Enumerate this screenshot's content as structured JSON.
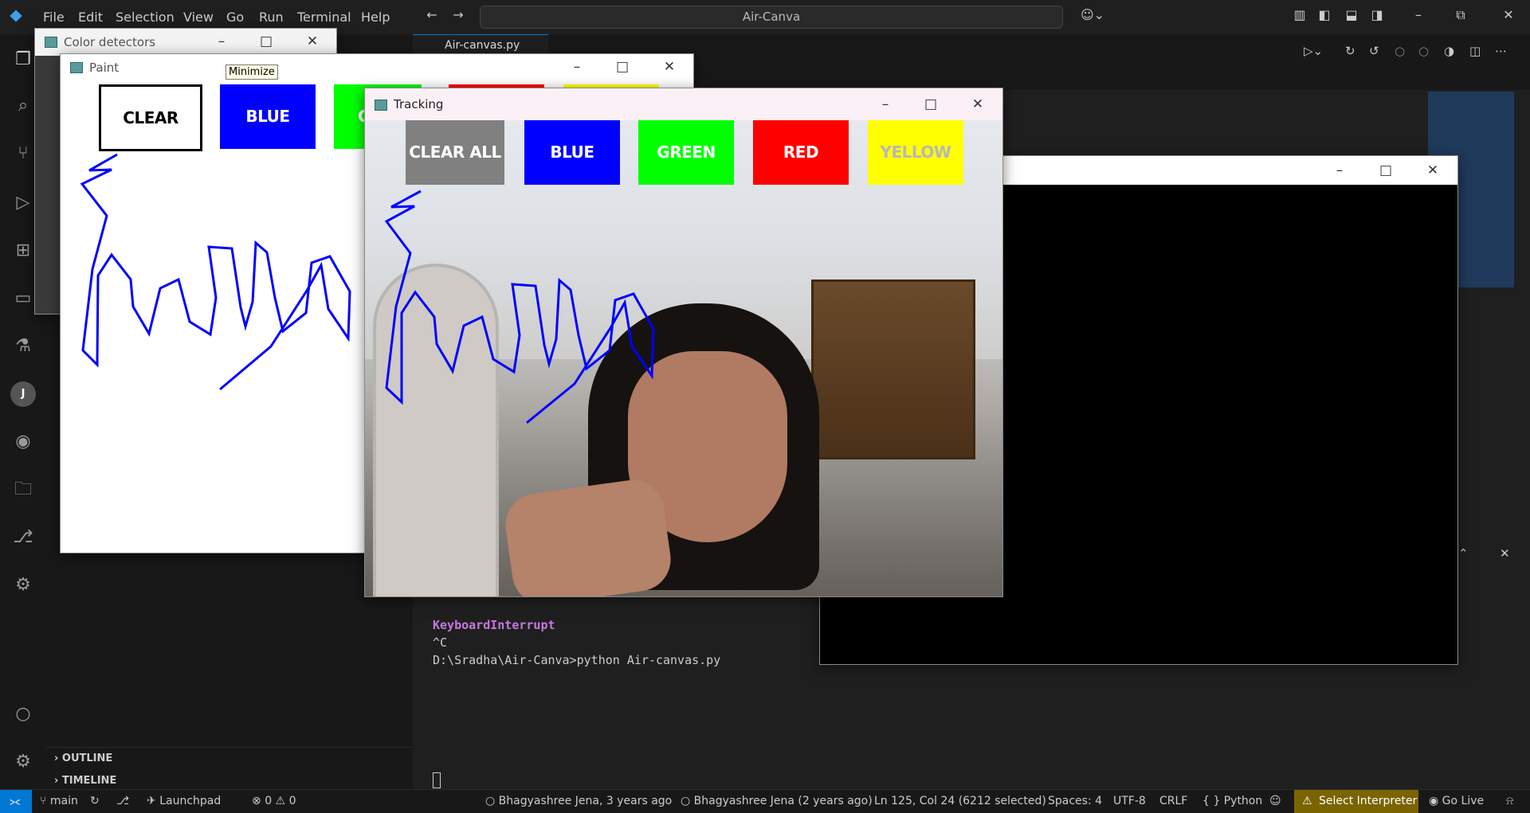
{
  "menu": [
    "File",
    "Edit",
    "Selection",
    "View",
    "Go",
    "Run",
    "Terminal",
    "Help"
  ],
  "search_label": "Air-Canva",
  "tab_label": "Air-canvas.py",
  "sidebar": {
    "outline": "OUTLINE",
    "timeline": "TIMELINE"
  },
  "terminal": {
    "error": "KeyboardInterrupt",
    "ctrlc": "^C",
    "prompt": "D:\\Sradha\\Air-Canva>python Air-canvas.py"
  },
  "windows": {
    "color_detectors": {
      "title": "Color detectors"
    },
    "paint": {
      "title": "Paint",
      "tooltip": "Minimize",
      "buttons": [
        "CLEAR",
        "BLUE",
        "G"
      ]
    },
    "tracking": {
      "title": "Tracking",
      "buttons": [
        "CLEAR ALL",
        "BLUE",
        "GREEN",
        "RED",
        "YELLOW"
      ]
    }
  },
  "status": {
    "branch": "main",
    "launchpad": "Launchpad",
    "errors": "0",
    "warnings": "0",
    "blame1": "Bhagyashree Jena, 3 years ago",
    "blame2": "Bhagyashree Jena (2 years ago)",
    "position": "Ln 125, Col 24 (6212 selected)",
    "spaces": "Spaces: 4",
    "encoding": "UTF-8",
    "eol": "CRLF",
    "language": "Python",
    "interpreter": "Select Interpreter",
    "golive": "Go Live"
  },
  "colors": {
    "accent": "#0078d4",
    "blue": "#0000ff",
    "green": "#00ff00",
    "red": "#ff0000",
    "yellow": "#ffff00",
    "interpreter_bg": "#7a6400"
  }
}
